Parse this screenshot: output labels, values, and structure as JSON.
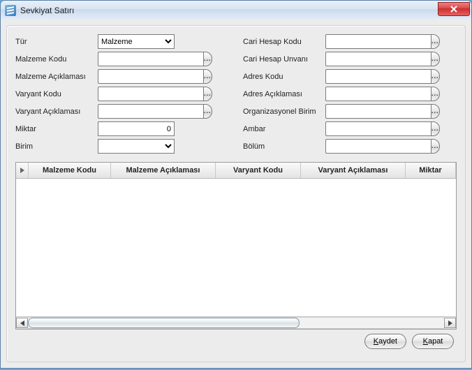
{
  "window": {
    "title": "Sevkiyat Satırı"
  },
  "form": {
    "left": {
      "tur_label": "Tür",
      "tur_value": "Malzeme",
      "malzeme_kodu_label": "Malzeme Kodu",
      "malzeme_kodu_value": "",
      "malzeme_aciklamasi_label": "Malzeme Açıklaması",
      "malzeme_aciklamasi_value": "",
      "varyant_kodu_label": "Varyant Kodu",
      "varyant_kodu_value": "",
      "varyant_aciklamasi_label": "Varyant Açıklaması",
      "varyant_aciklamasi_value": "",
      "miktar_label": "Miktar",
      "miktar_value": "0",
      "birim_label": "Birim",
      "birim_value": ""
    },
    "right": {
      "cari_hesap_kodu_label": "Cari Hesap Kodu",
      "cari_hesap_kodu_value": "",
      "cari_hesap_unvani_label": "Cari Hesap Unvanı",
      "cari_hesap_unvani_value": "",
      "adres_kodu_label": "Adres Kodu",
      "adres_kodu_value": "",
      "adres_aciklamasi_label": "Adres Açıklaması",
      "adres_aciklamasi_value": "",
      "organizasyonel_birim_label": "Organizasyonel Birim",
      "organizasyonel_birim_value": "",
      "ambar_label": "Ambar",
      "ambar_value": "",
      "bolum_label": "Bölüm",
      "bolum_value": ""
    }
  },
  "grid": {
    "columns": {
      "malzeme_kodu": "Malzeme Kodu",
      "malzeme_aciklamasi": "Malzeme Açıklaması",
      "varyant_kodu": "Varyant Kodu",
      "varyant_aciklamasi": "Varyant Açıklaması",
      "miktar": "Miktar"
    },
    "rows": []
  },
  "footer": {
    "kaydet_u": "K",
    "kaydet_rest": "aydet",
    "kapat_u": "K",
    "kapat_rest": "apat"
  },
  "lookup_glyph": "..."
}
